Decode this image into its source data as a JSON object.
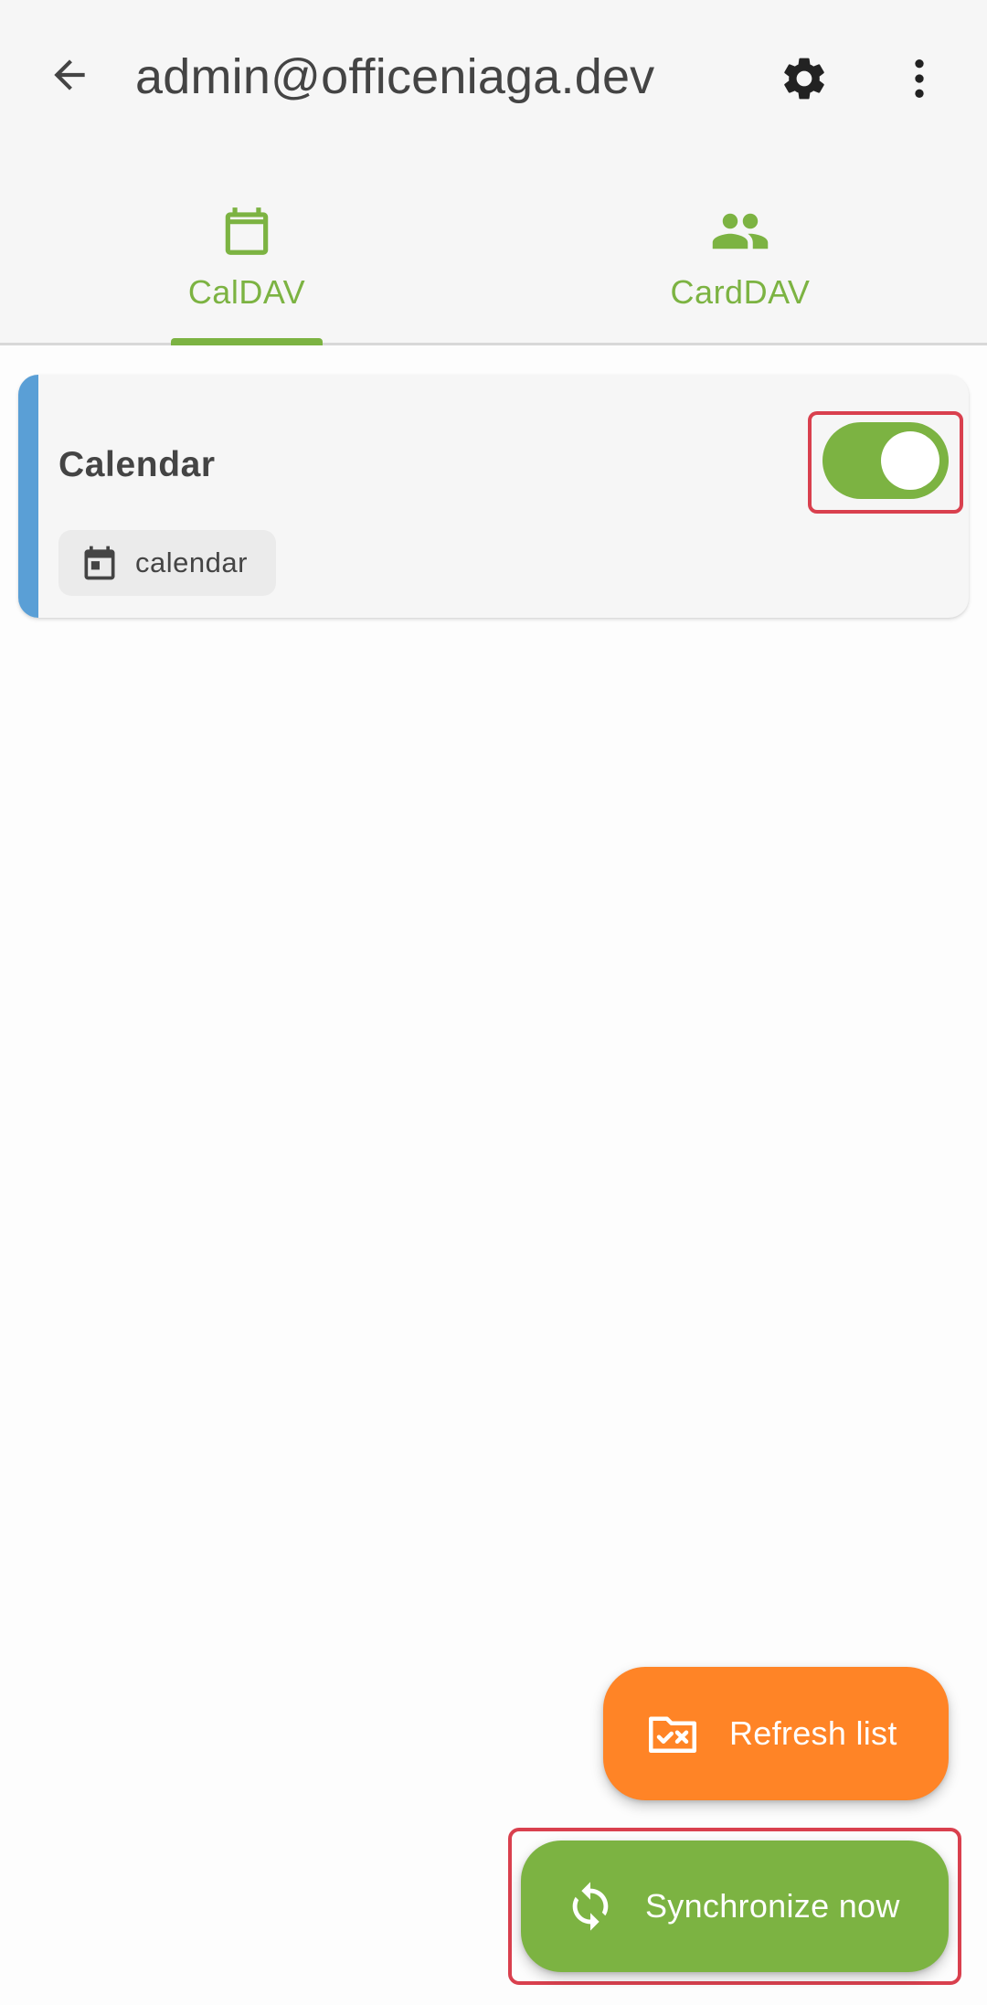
{
  "app_bar": {
    "title": "admin@officeniaga.dev",
    "back_icon": "arrow-left-icon",
    "settings_icon": "gear-icon",
    "more_icon": "more-vertical-icon"
  },
  "tabs": [
    {
      "label": "CalDAV",
      "icon": "calendar-icon",
      "selected": true
    },
    {
      "label": "CardDAV",
      "icon": "people-icon",
      "selected": false
    }
  ],
  "collections": [
    {
      "title": "Calendar",
      "chip_label": "calendar",
      "chip_icon": "calendar-event-icon",
      "color": "#5a9fd6",
      "sync_enabled": true
    }
  ],
  "actions": {
    "refresh_label": "Refresh list",
    "refresh_icon": "folder-sync-icon",
    "sync_label": "Synchronize now",
    "sync_icon": "sync-icon"
  },
  "colors": {
    "accent": "#7cb342",
    "refresh_fab": "#ff8426",
    "highlight_frame": "#d9404e"
  }
}
